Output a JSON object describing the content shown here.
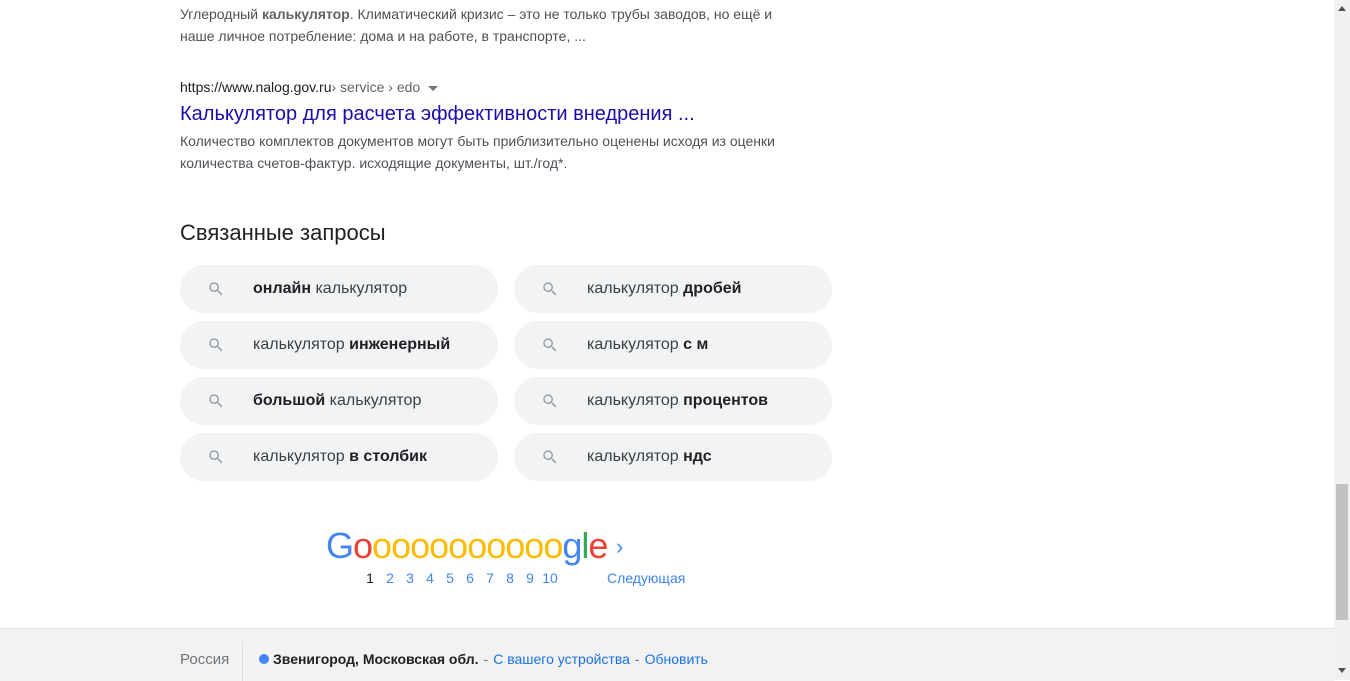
{
  "result1": {
    "snippet_parts": [
      "Углеродный ",
      "калькулятор",
      ". Климатический кризис – это не только трубы заводов, но ещё и наше личное потребление: дома и на работе, в транспорте, ..."
    ]
  },
  "result2": {
    "domain": "https://www.nalog.gov.ru",
    "path": " › service › edo",
    "title": "Калькулятор для расчета эффективности внедрения ...",
    "snippet": "Количество комплектов документов могут быть приблизительно оценены исходя из оценки количества счетов-фактур. исходящие документы, шт./год*."
  },
  "related": {
    "heading": "Связанные запросы",
    "items": [
      {
        "pre": "",
        "bold": "онлайн",
        "post": " калькулятор"
      },
      {
        "pre": "калькулятор ",
        "bold": "дробей",
        "post": ""
      },
      {
        "pre": "калькулятор ",
        "bold": "инженерный",
        "post": ""
      },
      {
        "pre": "калькулятор ",
        "bold": "с м",
        "post": ""
      },
      {
        "pre": "",
        "bold": "большой",
        "post": " калькулятор"
      },
      {
        "pre": "калькулятор ",
        "bold": "процентов",
        "post": ""
      },
      {
        "pre": "калькулятор ",
        "bold": "в столбик",
        "post": ""
      },
      {
        "pre": "калькулятор ",
        "bold": "ндс",
        "post": ""
      }
    ]
  },
  "pagination": {
    "logo_letters": [
      {
        "ch": "G",
        "color": "#4285f4"
      },
      {
        "ch": "o",
        "color": "#ea4335"
      },
      {
        "ch": "o",
        "color": "#fbbc05"
      },
      {
        "ch": "o",
        "color": "#fbbc05"
      },
      {
        "ch": "o",
        "color": "#fbbc05"
      },
      {
        "ch": "o",
        "color": "#fbbc05"
      },
      {
        "ch": "o",
        "color": "#fbbc05"
      },
      {
        "ch": "o",
        "color": "#fbbc05"
      },
      {
        "ch": "o",
        "color": "#fbbc05"
      },
      {
        "ch": "o",
        "color": "#fbbc05"
      },
      {
        "ch": "o",
        "color": "#fbbc05"
      },
      {
        "ch": "o",
        "color": "#fbbc05"
      },
      {
        "ch": "g",
        "color": "#4285f4"
      },
      {
        "ch": "l",
        "color": "#34a853"
      },
      {
        "ch": "e",
        "color": "#ea4335"
      }
    ],
    "current": "1",
    "pages": [
      "1",
      "2",
      "3",
      "4",
      "5",
      "6",
      "7",
      "8",
      "9",
      "10"
    ],
    "next_label": "Следующая",
    "next_chevron": "›"
  },
  "footer": {
    "country": "Россия",
    "location": "Звенигород, Московская обл.",
    "separator": "-",
    "device_link": "С вашего устройства",
    "update_link": "Обновить"
  }
}
